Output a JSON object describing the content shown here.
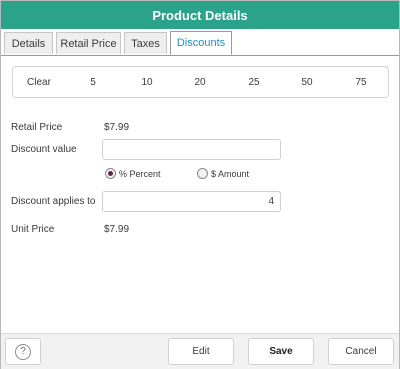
{
  "dialog": {
    "title": "Product Details"
  },
  "tabs": [
    {
      "label": "Details",
      "active": false
    },
    {
      "label": "Retail Price",
      "active": false
    },
    {
      "label": "Taxes",
      "active": false
    },
    {
      "label": "Discounts",
      "active": true
    }
  ],
  "discount_presets": [
    "Clear",
    "5",
    "10",
    "20",
    "25",
    "50",
    "75"
  ],
  "form": {
    "retail_price_label": "Retail Price",
    "retail_price_value": "$7.99",
    "discount_value_label": "Discount value",
    "discount_value": "",
    "radio_percent_label": "% Percent",
    "radio_amount_label": "$ Amount",
    "selected_type": "percent",
    "applies_to_label": "Discount applies to",
    "applies_to_value": "4",
    "unit_price_label": "Unit Price",
    "unit_price_value": "$7.99"
  },
  "footer": {
    "help_glyph": "?",
    "edit_label": "Edit",
    "save_label": "Save",
    "cancel_label": "Cancel"
  },
  "colors": {
    "titlebar": "#2aa38a",
    "active_tab_text": "#1f8fbf"
  },
  "icons": {
    "help": "help-icon",
    "radio_selected": "radio-selected-icon",
    "radio_unselected": "radio-unselected-icon"
  }
}
